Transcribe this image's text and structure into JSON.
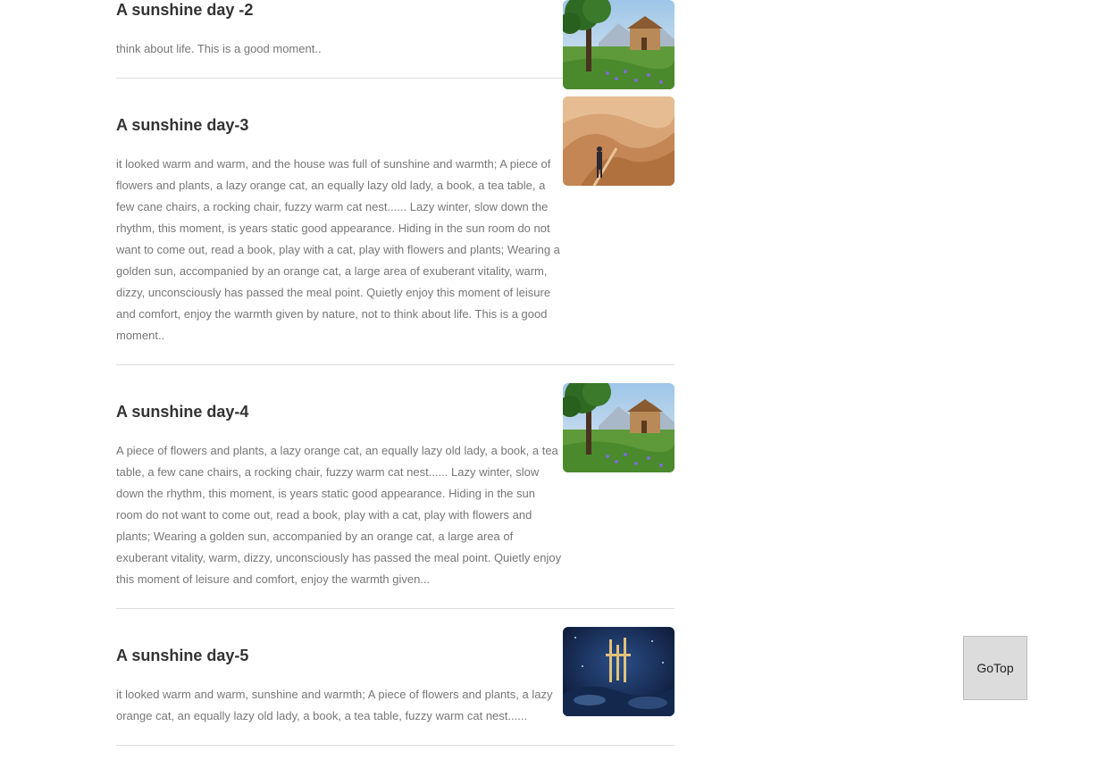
{
  "posts": [
    {
      "title": "A sunshine day -2",
      "excerpt": "think about life. This is a good moment..",
      "image": "cottage-meadow-image"
    },
    {
      "title": "A sunshine day-3",
      "excerpt": "it looked warm and warm, and the house was full of sunshine and warmth; A piece of flowers and plants, a lazy orange cat, an equally lazy old lady, a book, a tea table, a few cane chairs, a rocking chair, fuzzy warm cat nest...... Lazy winter, slow down the rhythm, this moment, is years static good appearance. Hiding in the sun room do not want to come out, read a book, play with a cat, play with flowers and plants; Wearing a golden sun, accompanied by an orange cat, a large area of exuberant vitality, warm, dizzy, unconsciously has passed the meal point. Quietly enjoy this moment of leisure and comfort, enjoy the warmth given by nature, not to think about life. This is a good moment..",
      "image": "desert-walker-image"
    },
    {
      "title": "A sunshine day-4",
      "excerpt": "A piece of flowers and plants, a lazy orange cat, an equally lazy old lady, a book, a tea table, a few cane chairs, a rocking chair, fuzzy warm cat nest...... Lazy winter, slow down the rhythm, this moment, is years static good appearance. Hiding in the sun room do not want to come out, read a book, play with a cat, play with flowers and plants; Wearing a golden sun, accompanied by an orange cat, a large area of exuberant vitality, warm, dizzy, unconsciously has passed the meal point. Quietly enjoy this moment of leisure and comfort, enjoy the warmth given...",
      "image": "cottage-meadow-image"
    },
    {
      "title": "A sunshine day-5",
      "excerpt": "it looked warm and warm, sunshine and warmth; A piece of flowers and plants, a lazy orange cat, an equally lazy old lady, a book, a tea table, fuzzy warm cat nest......",
      "image": "night-poster-image"
    }
  ],
  "gotop": {
    "label": "GoTop"
  },
  "colors": {
    "title": "#333333",
    "excerpt": "#777777",
    "divider": "#dddddd",
    "gotop_bg": "#dcdcdc"
  }
}
